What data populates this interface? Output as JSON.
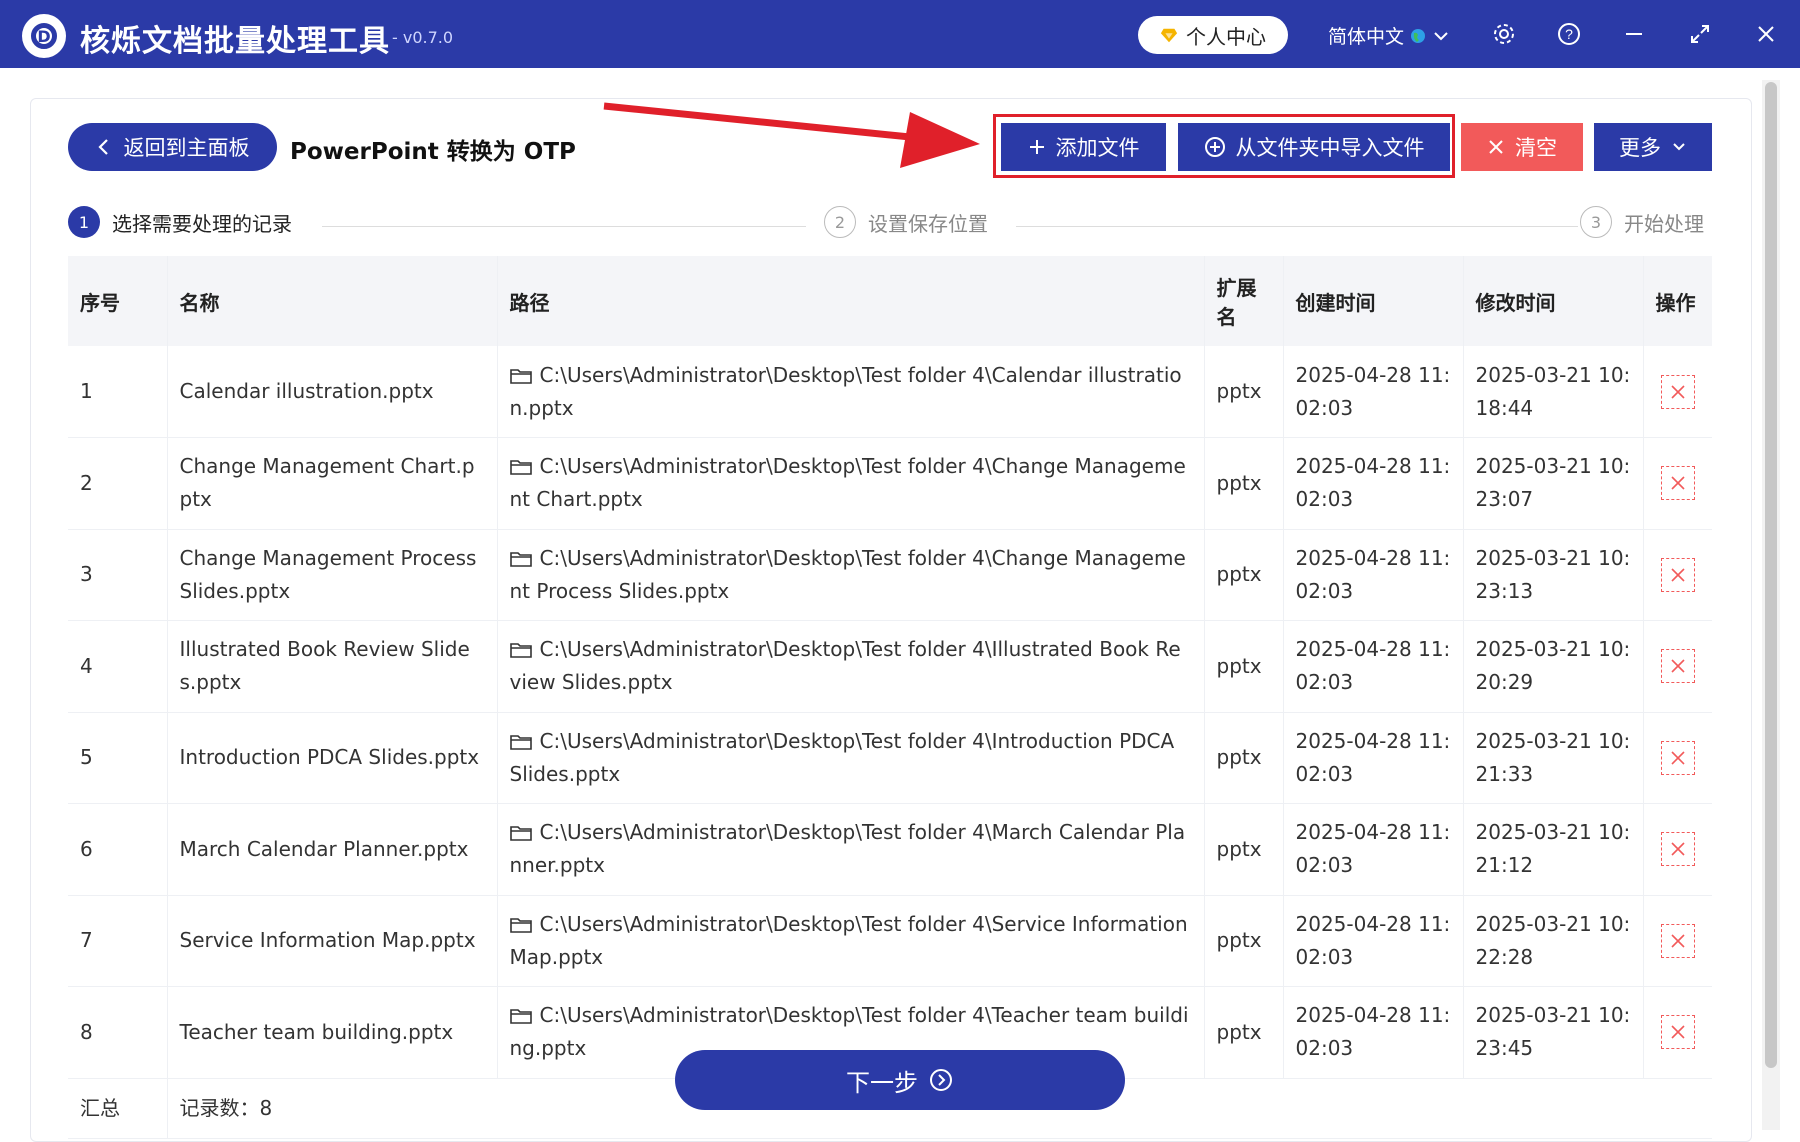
{
  "titlebar": {
    "app_name": "核烁文档批量处理工具",
    "version": "- v0.7.0",
    "user_center": "个人中心",
    "language": "简体中文",
    "colors": {
      "bar": "#2b3aa7"
    }
  },
  "toolbar": {
    "back_label": "返回到主面板",
    "page_title": "PowerPoint 转换为 OTP",
    "add_file": "添加文件",
    "import_folder": "从文件夹中导入文件",
    "clear": "清空",
    "more": "更多",
    "colors": {
      "primary": "#2b3aa7",
      "danger": "#f25a5a",
      "highlight": "#e0202a"
    }
  },
  "steps": [
    {
      "num": "1",
      "label": "选择需要处理的记录"
    },
    {
      "num": "2",
      "label": "设置保存位置"
    },
    {
      "num": "3",
      "label": "开始处理"
    }
  ],
  "table": {
    "headers": [
      "序号",
      "名称",
      "路径",
      "扩展名",
      "创建时间",
      "修改时间",
      "操作"
    ],
    "rows": [
      {
        "idx": "1",
        "name": "Calendar illustration.pptx",
        "path": "C:\\Users\\Administrator\\Desktop\\Test folder 4\\Calendar illustration.pptx",
        "ext": "pptx",
        "created": "2025-04-28 11:02:03",
        "modified": "2025-03-21 10:18:44"
      },
      {
        "idx": "2",
        "name": "Change Management Chart.pptx",
        "path": "C:\\Users\\Administrator\\Desktop\\Test folder 4\\Change Management Chart.pptx",
        "ext": "pptx",
        "created": "2025-04-28 11:02:03",
        "modified": "2025-03-21 10:23:07"
      },
      {
        "idx": "3",
        "name": "Change Management Process Slides.pptx",
        "path": "C:\\Users\\Administrator\\Desktop\\Test folder 4\\Change Management Process Slides.pptx",
        "ext": "pptx",
        "created": "2025-04-28 11:02:03",
        "modified": "2025-03-21 10:23:13"
      },
      {
        "idx": "4",
        "name": "Illustrated Book Review Slides.pptx",
        "path": "C:\\Users\\Administrator\\Desktop\\Test folder 4\\Illustrated Book Review Slides.pptx",
        "ext": "pptx",
        "created": "2025-04-28 11:02:03",
        "modified": "2025-03-21 10:20:29"
      },
      {
        "idx": "5",
        "name": "Introduction PDCA Slides.pptx",
        "path": "C:\\Users\\Administrator\\Desktop\\Test folder 4\\Introduction PDCA Slides.pptx",
        "ext": "pptx",
        "created": "2025-04-28 11:02:03",
        "modified": "2025-03-21 10:21:33"
      },
      {
        "idx": "6",
        "name": "March Calendar Planner.pptx",
        "path": "C:\\Users\\Administrator\\Desktop\\Test folder 4\\March Calendar Planner.pptx",
        "ext": "pptx",
        "created": "2025-04-28 11:02:03",
        "modified": "2025-03-21 10:21:12"
      },
      {
        "idx": "7",
        "name": "Service Information Map.pptx",
        "path": "C:\\Users\\Administrator\\Desktop\\Test folder 4\\Service Information Map.pptx",
        "ext": "pptx",
        "created": "2025-04-28 11:02:03",
        "modified": "2025-03-21 10:22:28"
      },
      {
        "idx": "8",
        "name": "Teacher team building.pptx",
        "path": "C:\\Users\\Administrator\\Desktop\\Test folder 4\\Teacher team building.pptx",
        "ext": "pptx",
        "created": "2025-04-28 11:02:03",
        "modified": "2025-03-21 10:23:45"
      }
    ],
    "summary": {
      "label": "汇总",
      "count": "记录数：8"
    }
  },
  "footer": {
    "next_label": "下一步"
  }
}
